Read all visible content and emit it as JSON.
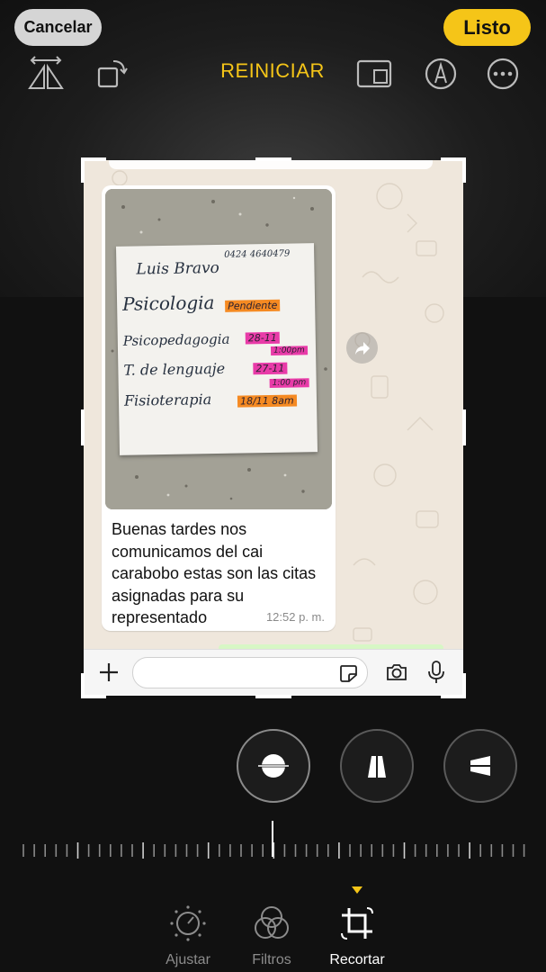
{
  "header": {
    "cancel_label": "Cancelar",
    "done_label": "Listo",
    "reset_label": "REINICIAR"
  },
  "toolbar_icons": [
    "flip-horizontal-icon",
    "rotate-icon",
    "aspect-ratio-icon",
    "markup-pen-icon",
    "more-options-icon"
  ],
  "photo": {
    "paper_lines": {
      "phone": "0424 4640479",
      "name": "Luis   Bravo",
      "line1": "Psicologia",
      "line1_tag": "Pendiente",
      "line2": "Psicopedagogia",
      "line2_tag": "28-11",
      "line2_time": "1:00pm",
      "line3": "T. de lenguaje",
      "line3_tag": "27-11",
      "line3_time": "1:00 pm",
      "line4": "Fisioterapia",
      "line4_tag": "18/11  8am"
    }
  },
  "message": {
    "text": "Buenas tardes nos comunicamos del cai carabobo estas son las citas asignadas para su representado",
    "time": "12:52 p. m."
  },
  "chat_input": {
    "icons": [
      "plus-icon",
      "sticker-icon",
      "camera-icon",
      "microphone-icon"
    ]
  },
  "perspective_buttons": [
    "straighten-icon",
    "vertical-perspective-icon",
    "horizontal-perspective-icon"
  ],
  "tabs": [
    {
      "label": "Ajustar",
      "icon": "adjust-dial-icon",
      "active": false
    },
    {
      "label": "Filtros",
      "icon": "filters-icon",
      "active": false
    },
    {
      "label": "Recortar",
      "icon": "crop-icon",
      "active": true
    }
  ],
  "colors": {
    "accent": "#f5c518",
    "background": "#111111",
    "chat_wallpaper": "#efe7dc"
  }
}
